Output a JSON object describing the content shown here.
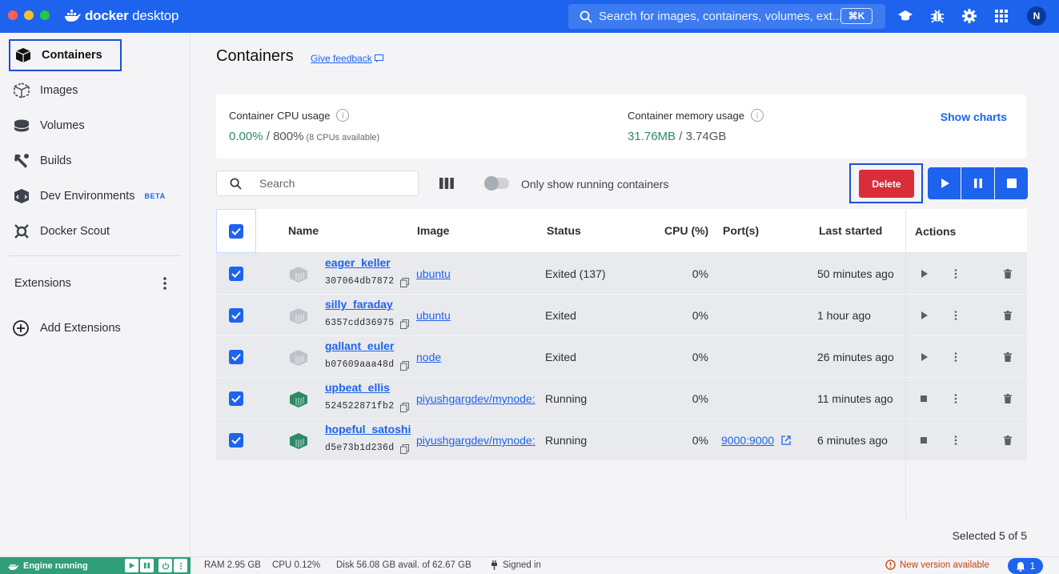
{
  "titlebar": {
    "app_name_bold": "docker",
    "app_name_rest": " desktop",
    "search_placeholder": "Search for images, containers, volumes, ext...",
    "search_shortcut": "⌘K",
    "avatar_initial": "N"
  },
  "sidebar": {
    "items": [
      {
        "label": "Containers",
        "icon": "container-icon"
      },
      {
        "label": "Images",
        "icon": "images-icon"
      },
      {
        "label": "Volumes",
        "icon": "volumes-icon"
      },
      {
        "label": "Builds",
        "icon": "builds-icon"
      },
      {
        "label": "Dev Environments",
        "icon": "dev-environments-icon",
        "badge": "BETA"
      },
      {
        "label": "Docker Scout",
        "icon": "scout-icon"
      }
    ],
    "extensions_label": "Extensions",
    "add_extensions_label": "Add Extensions"
  },
  "page": {
    "title": "Containers",
    "feedback": "Give feedback"
  },
  "stats": {
    "cpu_label": "Container CPU usage",
    "cpu_used": "0.00%",
    "cpu_sep": " / ",
    "cpu_total": "800%",
    "cpu_note": " (8 CPUs available)",
    "mem_label": "Container memory usage",
    "mem_used": "31.76MB",
    "mem_sep": " / ",
    "mem_total": "3.74GB",
    "show_charts": "Show charts"
  },
  "toolbar": {
    "search_placeholder": "Search",
    "toggle_label": "Only show running containers",
    "delete_label": "Delete"
  },
  "table": {
    "columns": [
      "Name",
      "Image",
      "Status",
      "CPU (%)",
      "Port(s)",
      "Last started",
      "Actions"
    ],
    "rows": [
      {
        "name": "eager_keller",
        "id": "307064db7872",
        "image": "ubuntu",
        "status": "Exited (137)",
        "cpu": "0%",
        "port": "",
        "last": "50 minutes ago",
        "running": false
      },
      {
        "name": "silly_faraday",
        "id": "6357cdd36975",
        "image": "ubuntu",
        "status": "Exited",
        "cpu": "0%",
        "port": "",
        "last": "1 hour ago",
        "running": false
      },
      {
        "name": "gallant_euler",
        "id": "b07609aaa48d",
        "image": "node",
        "status": "Exited",
        "cpu": "0%",
        "port": "",
        "last": "26 minutes ago",
        "running": false
      },
      {
        "name": "upbeat_ellis",
        "id": "524522871fb2",
        "image": "piyushgargdev/mynode:",
        "status": "Running",
        "cpu": "0%",
        "port": "",
        "last": "11 minutes ago",
        "running": true
      },
      {
        "name": "hopeful_satoshi",
        "id": "d5e73b1d236d",
        "image": "piyushgargdev/mynode:",
        "status": "Running",
        "cpu": "0%",
        "port": "9000:9000",
        "last": "6 minutes ago",
        "running": true
      }
    ],
    "selected_text": "Selected 5 of 5"
  },
  "footer": {
    "engine": "Engine running",
    "ram": "RAM 2.95 GB",
    "cpu": "CPU 0.12%",
    "disk": "Disk 56.08 GB avail. of 62.67 GB",
    "signed": "Signed in",
    "new_version": "New version available",
    "notifications": "1"
  },
  "colors": {
    "accent": "#1d63ed",
    "danger": "#d92d3a",
    "engine_green": "#2f9e79",
    "running_green": "#2c8a67"
  }
}
